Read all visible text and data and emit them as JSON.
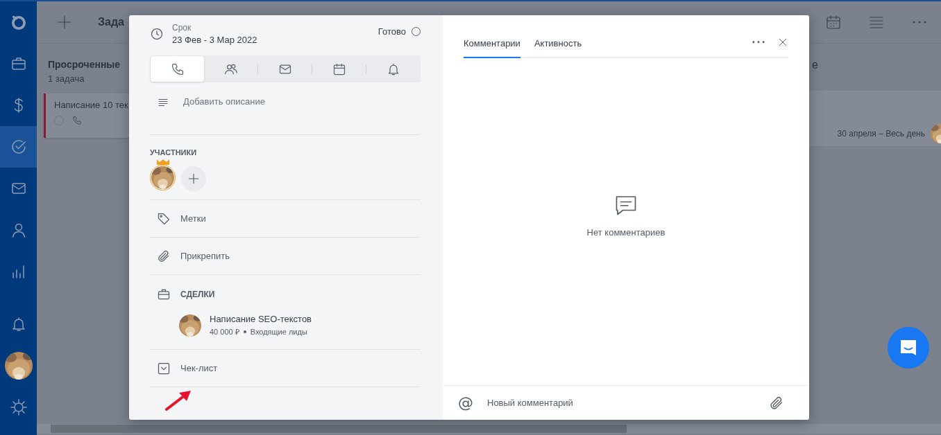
{
  "nav": [
    {
      "selected": false
    },
    {
      "selected": false
    },
    {
      "selected": false
    },
    {
      "selected": true
    },
    {
      "selected": false
    },
    {
      "selected": false
    },
    {
      "selected": false
    }
  ],
  "toolbar": {
    "title": "Зада"
  },
  "overdue_column": {
    "title": "Просроченные",
    "count": "1 задача",
    "card": {
      "title": "Написание 10 тек",
      "done": false
    }
  },
  "right_column": {
    "title": "е",
    "card": {
      "date": "30 апреля – Весь день"
    }
  },
  "task": {
    "deadline_label": "Срок",
    "deadline": "23 Фев - 3 Мар 2022",
    "done_label": "Готово",
    "done": false,
    "activity_types": [
      {
        "selected": true
      },
      {
        "selected": false
      },
      {
        "selected": false
      },
      {
        "selected": false
      },
      {
        "selected": false
      }
    ],
    "description_placeholder": "Добавить описание",
    "participants_heading": "УЧАСТНИКИ",
    "tags_label": "Метки",
    "attach_label": "Прикрепить",
    "deals_heading": "СДЕЛКИ",
    "deals": [
      {
        "title": "Написание SEO-текстов",
        "amount": "40 000 ₽",
        "stage": "Входящие лиды"
      }
    ],
    "checklist_label": "Чек-лист"
  },
  "comments": {
    "tabs": [
      {
        "label": "Комментарии",
        "selected": true
      },
      {
        "label": "Активность",
        "selected": false
      }
    ],
    "empty_text": "Нет комментариев",
    "mention": "@",
    "placeholder": "Новый комментарий"
  }
}
